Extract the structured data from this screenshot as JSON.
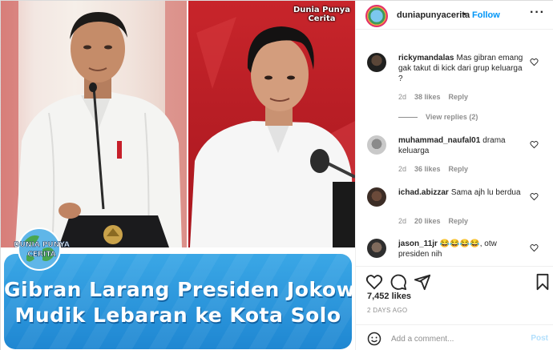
{
  "media": {
    "brand_tag_line1": "Dunia Punya",
    "brand_tag_line2": "Cerita",
    "badge_line1": "DUNIA PUNYA",
    "badge_line2": "CERITA",
    "title_line1": "Gibran Larang Presiden Jokowi",
    "title_line2": "Mudik Lebaran ke Kota Solo",
    "banner_color": "#1f87d2"
  },
  "header": {
    "username": "duniapunyacerita",
    "separator": "•",
    "follow_label": "Follow",
    "more_label": "···",
    "follow_color": "#0095f6"
  },
  "comments": [
    {
      "username": "rickymandalas",
      "text": "Mas gibran emang gak takut di kick dari grup keluarga ?",
      "age": "2d",
      "likes": "38 likes",
      "reply_label": "Reply",
      "view_replies": "View replies (2)"
    },
    {
      "username": "muhammad_naufal01",
      "text": "drama keluarga",
      "age": "2d",
      "likes": "36 likes",
      "reply_label": "Reply"
    },
    {
      "username": "ichad.abizzar",
      "text": "Sama ajh lu berdua",
      "age": "2d",
      "likes": "20 likes",
      "reply_label": "Reply"
    },
    {
      "username": "jason_11jr",
      "text": "😂😂😂😂, otw presiden nih"
    }
  ],
  "actions": {
    "like_icon": "heart-icon",
    "comment_icon": "comment-icon",
    "share_icon": "share-icon",
    "save_icon": "bookmark-icon"
  },
  "likes_count": "7,452 likes",
  "timestamp": "2 DAYS AGO",
  "add_comment": {
    "placeholder": "Add a comment...",
    "post_label": "Post"
  }
}
